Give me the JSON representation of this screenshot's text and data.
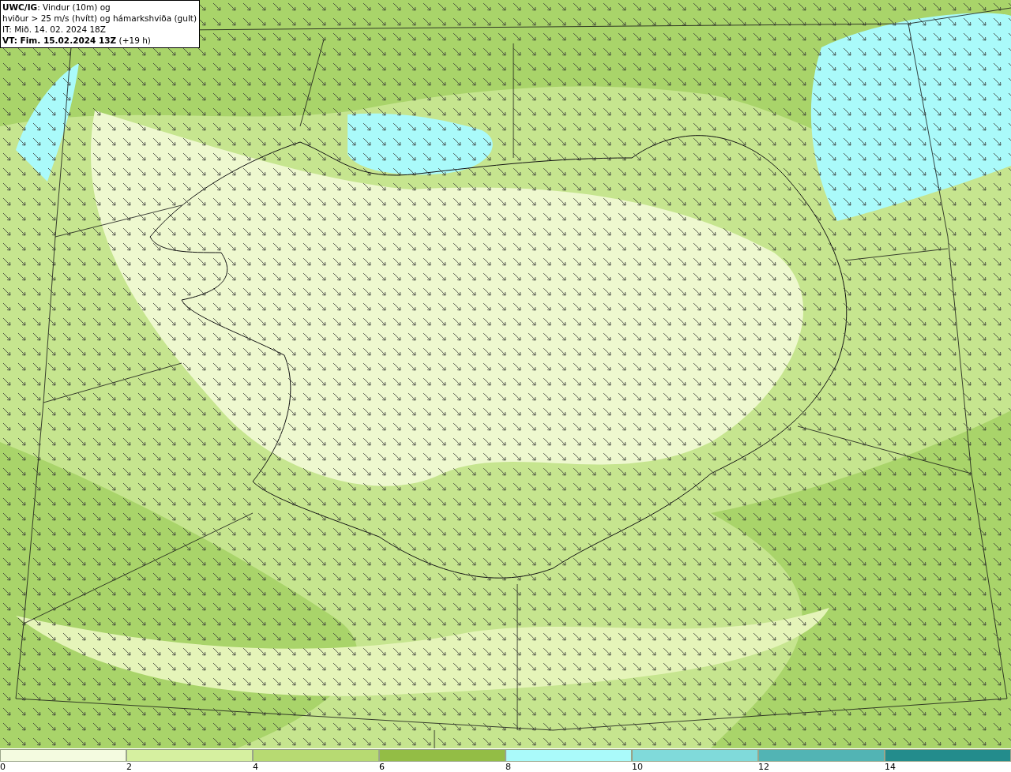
{
  "header": {
    "lines": [
      "**UWC/IG**: Vindur (10m) og",
      "hviður > 25 m/s (hvítt) og hámarkshviða (gult)",
      "IT: Mið. 14. 02. 2024 18Z",
      "**VT: Fim. 15.02.2024 13Z** (+19 h)"
    ]
  },
  "legend": [
    {
      "label": "0",
      "color": "#f4fbe0"
    },
    {
      "label": "2",
      "color": "#d6f0a0"
    },
    {
      "label": "4",
      "color": "#b7da72"
    },
    {
      "label": "6",
      "color": "#93bd45"
    },
    {
      "label": "8",
      "color": "#aafafa"
    },
    {
      "label": "10",
      "color": "#80dada"
    },
    {
      "label": "12",
      "color": "#52b4b4"
    },
    {
      "label": "14",
      "color": "#238c8c"
    }
  ]
}
